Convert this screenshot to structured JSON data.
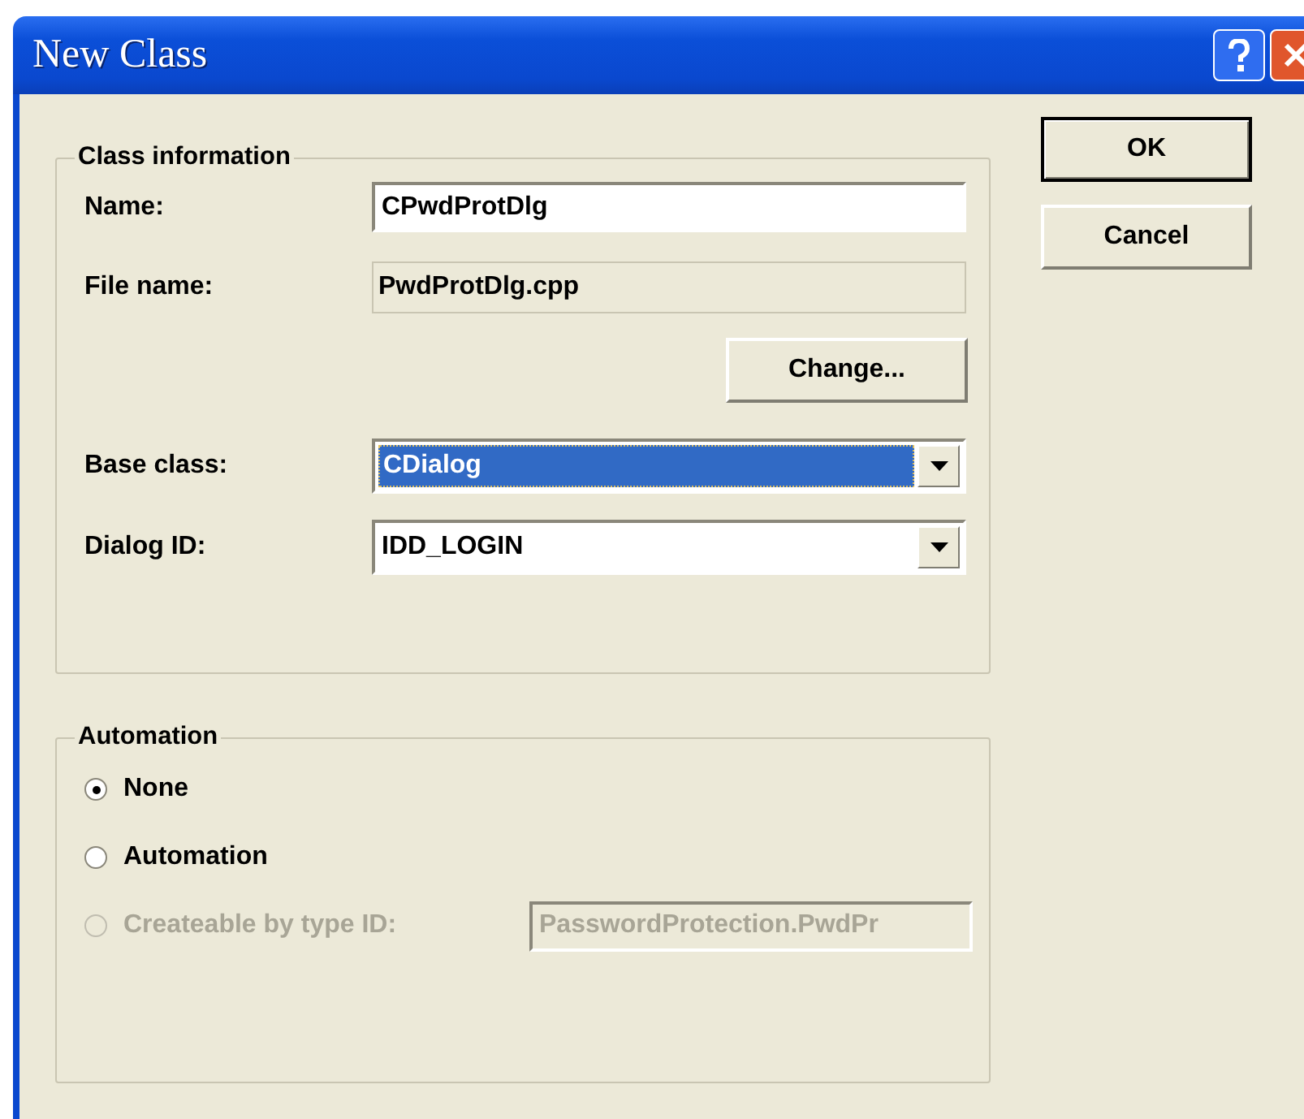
{
  "window": {
    "title": "New Class"
  },
  "class_information": {
    "title": "Class information",
    "name": {
      "label": "Name:",
      "value": "CPwdProtDlg"
    },
    "file_name": {
      "label": "File name:",
      "value": "PwdProtDlg.cpp"
    },
    "change_button": "Change...",
    "base_class": {
      "label": "Base class:",
      "value": "CDialog",
      "selected": true
    },
    "dialog_id": {
      "label": "Dialog ID:",
      "value": "IDD_LOGIN",
      "selected": false
    }
  },
  "automation": {
    "title": "Automation",
    "options": [
      {
        "label": "None",
        "selected": true,
        "disabled": false
      },
      {
        "label": "Automation",
        "selected": false,
        "disabled": false
      },
      {
        "label": "Createable by type ID:",
        "selected": false,
        "disabled": true
      }
    ],
    "type_id": {
      "value": "PasswordProtection.PwdPr",
      "disabled": true
    }
  },
  "buttons": [
    "OK",
    "Cancel"
  ]
}
